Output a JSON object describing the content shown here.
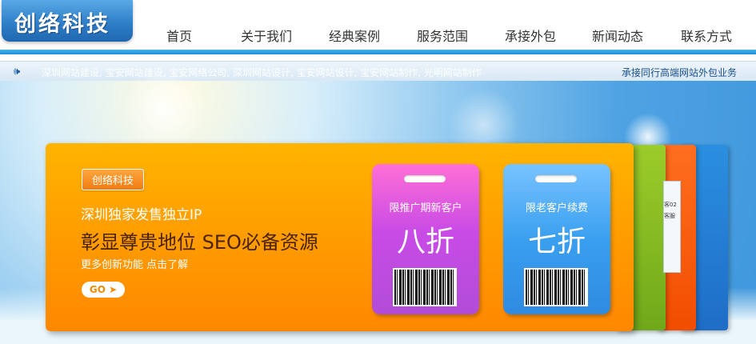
{
  "brand": {
    "logo_text": "创络科技"
  },
  "nav": [
    {
      "label": "首页"
    },
    {
      "label": "关于我们"
    },
    {
      "label": "经典案例"
    },
    {
      "label": "服务范围"
    },
    {
      "label": "承接外包"
    },
    {
      "label": "新闻动态"
    },
    {
      "label": "联系方式"
    }
  ],
  "ticker": {
    "text": "深圳网站建设, 宝安网站建设, 宝安网络公司, 深圳网站设计, 宝安网站设计, 宝安网站制作, 光明网站制作",
    "right_text": "承接同行高端网站外包业务"
  },
  "banner": {
    "badge": "创络科技",
    "line1": "深圳独家发售独立IP",
    "line2": "彰显尊贵地位 SEO必备资源",
    "line3": "更多创新功能 点击了解",
    "go_label": "GO ➤",
    "tags": [
      {
        "title": "限推广期新客户",
        "discount": "八折"
      },
      {
        "title": "限老客户续费",
        "discount": "七折"
      }
    ],
    "side_panel_items": [
      "",
      "客02",
      "",
      "",
      "客服"
    ]
  },
  "colors": {
    "accent_blue": "#2f7fc9",
    "banner_orange": "#ff9a00",
    "tag_purple": "#c94be6",
    "tag_blue": "#3a9fef"
  }
}
